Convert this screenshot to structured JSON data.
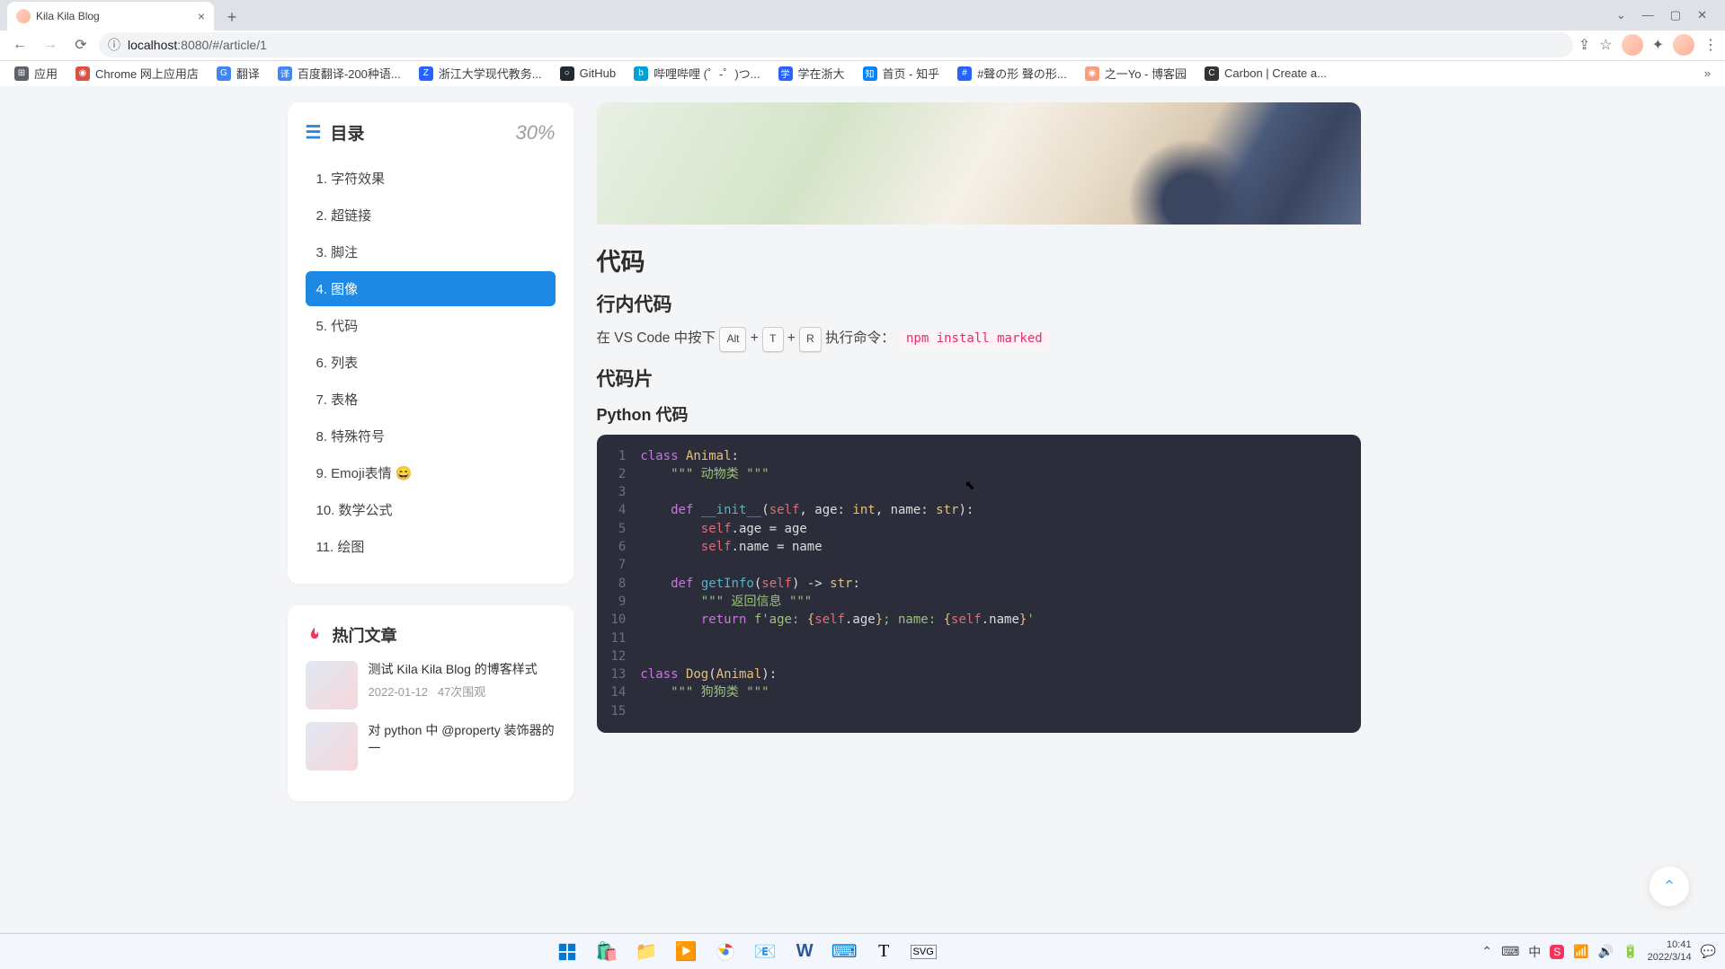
{
  "browser": {
    "tab_title": "Kila Kila Blog",
    "url_host": "localhost",
    "url_port_path": ":8080/#/article/1",
    "bookmarks": [
      {
        "label": "应用",
        "color": "#5f6368"
      },
      {
        "label": "Chrome 网上应用店",
        "color": "#dd5144"
      },
      {
        "label": "翻译",
        "color": "#4285f4"
      },
      {
        "label": "百度翻译-200种语...",
        "color": "#4285f4"
      },
      {
        "label": "浙江大学现代教务...",
        "color": "#2962ff"
      },
      {
        "label": "GitHub",
        "color": "#24292e"
      },
      {
        "label": "哔哩哔哩 (゜-゜)つ...",
        "color": "#00a1d6"
      },
      {
        "label": "学在浙大",
        "color": "#2962ff"
      },
      {
        "label": "首页 - 知乎",
        "color": "#0084ff"
      },
      {
        "label": "#聲の形 聲の形...",
        "color": "#2962ff"
      },
      {
        "label": "之一Yo - 博客园",
        "color": "#ff9a76"
      },
      {
        "label": "Carbon | Create a...",
        "color": "#333"
      }
    ]
  },
  "toc": {
    "title": "目录",
    "percent": "30%",
    "items": [
      "1. 字符效果",
      "2. 超链接",
      "3. 脚注",
      "4. 图像",
      "5. 代码",
      "6. 列表",
      "7. 表格",
      "8. 特殊符号",
      "9. Emoji表情 😄",
      "10. 数学公式",
      "11. 绘图"
    ],
    "active_index": 3
  },
  "hot": {
    "title": "热门文章",
    "items": [
      {
        "title": "测试 Kila Kila Blog 的博客样式",
        "date": "2022-01-12",
        "views": "47次围观"
      },
      {
        "title": "对 python 中 @property 装饰器的一",
        "date": "",
        "views": ""
      }
    ]
  },
  "article": {
    "h_code": "代码",
    "h_inline": "行内代码",
    "inline_prefix": "在 VS Code 中按下 ",
    "kbd1": "Alt",
    "plus": " + ",
    "kbd2": "T",
    "kbd3": "R",
    "inline_suffix": " 执行命令：",
    "inline_cmd": "npm install marked",
    "h_snippet": "代码片",
    "h_python": "Python 代码"
  },
  "taskbar": {
    "time": "10:41",
    "date": "2022/3/14"
  }
}
